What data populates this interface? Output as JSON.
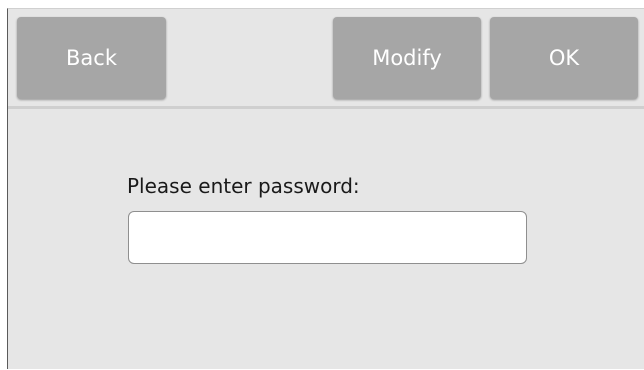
{
  "toolbar": {
    "back_label": "Back",
    "modify_label": "Modify",
    "ok_label": "OK"
  },
  "dialog": {
    "prompt": "Please enter password:",
    "password_value": "",
    "password_placeholder": ""
  },
  "colors": {
    "background": "#e6e6e6",
    "button": "#a6a6a6",
    "button_text": "#ffffff",
    "input_background": "#ffffff"
  }
}
